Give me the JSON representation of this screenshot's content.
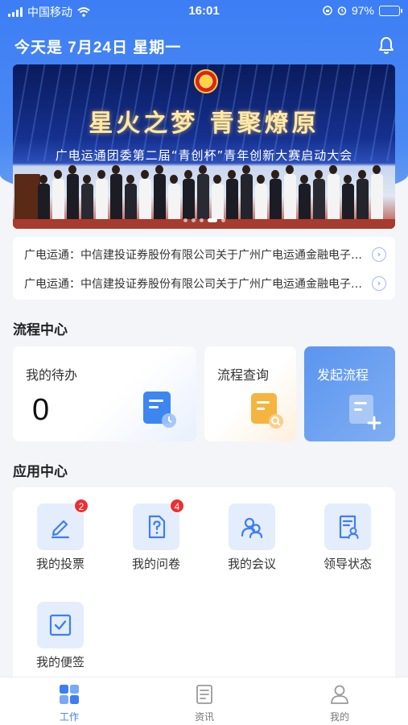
{
  "status_bar": {
    "carrier": "中国移动",
    "time": "16:01",
    "battery": "97%",
    "battery_level": 0.97
  },
  "header": {
    "date_text": "今天是 7月24日  星期一"
  },
  "banner": {
    "title": "星火之梦  青聚燎原",
    "subtitle": "广电运通团委第二届“青创杯”青年创新大赛启动大会",
    "slide_count": 5,
    "active_slide": 3
  },
  "news": [
    {
      "text": "广电运通：中信建投证券股份有限公司关于广州广电运通金融电子股份有限公司"
    },
    {
      "text": "广电运通：中信建投证券股份有限公司关于广州广电运通金融电子股份有限公司"
    }
  ],
  "flow_center": {
    "title": "流程中心",
    "todo_label": "我的待办",
    "todo_count": "0",
    "query_label": "流程查询",
    "start_label": "发起流程"
  },
  "app_center": {
    "title": "应用中心",
    "apps": [
      {
        "label": "我的投票",
        "badge": "2",
        "icon": "pen-icon"
      },
      {
        "label": "我的问卷",
        "badge": "4",
        "icon": "questionnaire-icon"
      },
      {
        "label": "我的会议",
        "badge": "",
        "icon": "meeting-people-icon"
      },
      {
        "label": "领导状态",
        "badge": "",
        "icon": "leader-status-icon"
      },
      {
        "label": "我的便签",
        "badge": "",
        "icon": "checkbox-note-icon"
      }
    ]
  },
  "tabbar": {
    "tabs": [
      {
        "label": "工作",
        "icon": "grid-icon",
        "active": true
      },
      {
        "label": "资讯",
        "icon": "news-icon",
        "active": false
      },
      {
        "label": "我的",
        "icon": "user-icon",
        "active": false
      }
    ]
  },
  "colors": {
    "primary": "#3d7ef5",
    "badge": "#ee2e31",
    "tile": "#e4edfc"
  }
}
